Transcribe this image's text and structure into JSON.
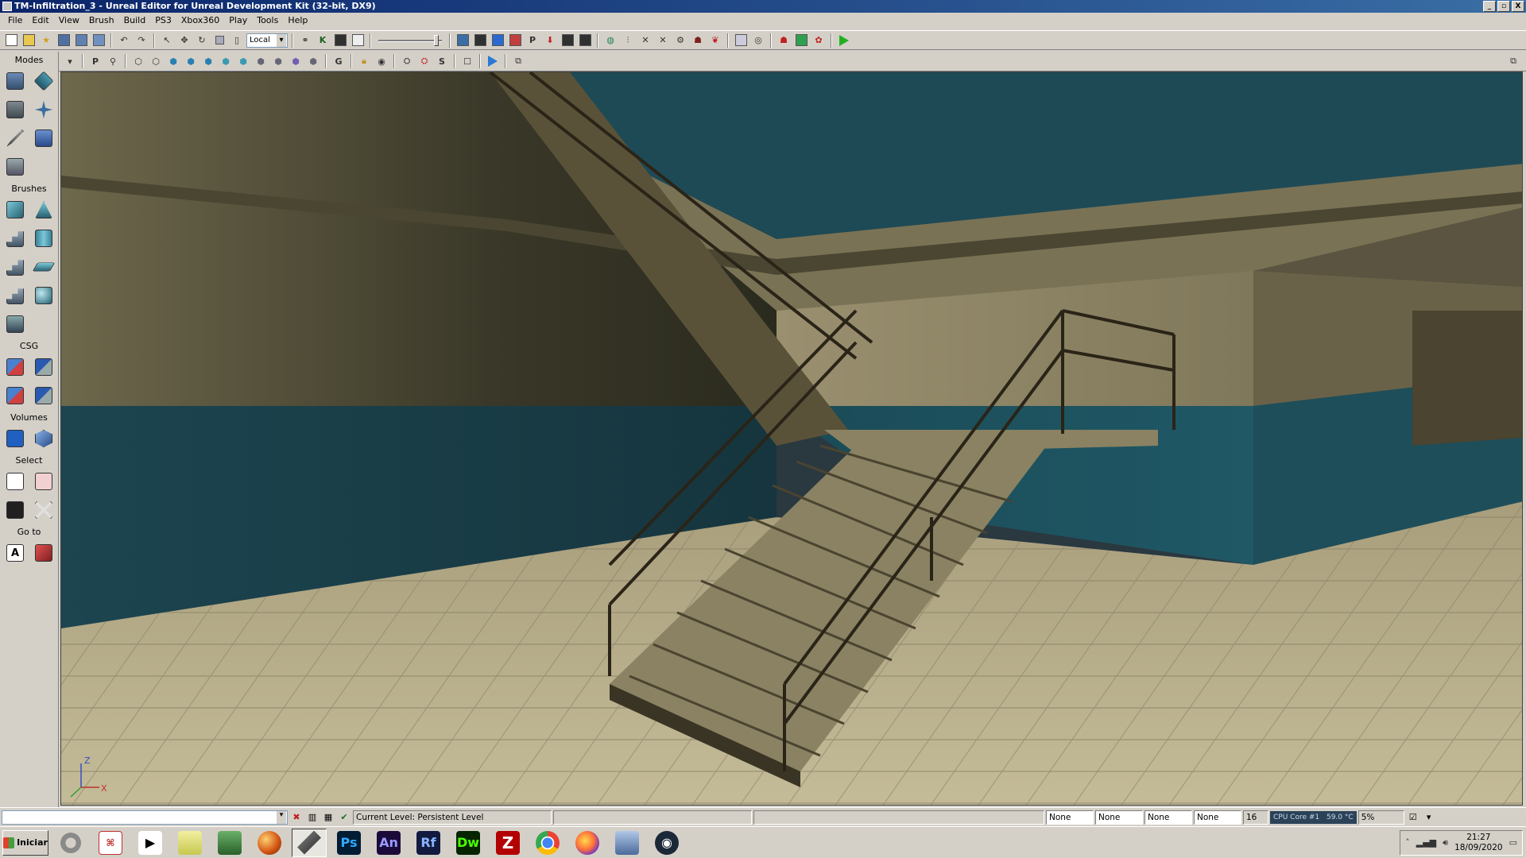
{
  "window": {
    "title": "TM-Infiltration_3 - Unreal Editor for Unreal Development Kit (32-bit, DX9)",
    "minimize": "_",
    "maximize": "▫",
    "close": "X"
  },
  "menu": [
    "File",
    "Edit",
    "View",
    "Brush",
    "Build",
    "PS3",
    "Xbox360",
    "Play",
    "Tools",
    "Help"
  ],
  "toolbar": {
    "coord_system": "Local",
    "viewport_bold_labels": {
      "p": "P",
      "g": "G",
      "s": "S",
      "k": "K"
    }
  },
  "modes_panel": {
    "modes_header": "Modes",
    "brushes_header": "Brushes",
    "csg_header": "CSG",
    "volumes_header": "Volumes",
    "select_header": "Select",
    "goto_header": "Go to",
    "goto_actor_label": "A"
  },
  "viewport": {
    "axis_z": "Z",
    "axis_x": "X",
    "colors": {
      "wall_upper": "#8c8460",
      "wall_lower": "#1e4a56",
      "floor": "#b8ae8a",
      "stair": "#9a9070",
      "rail": "#2a2418"
    }
  },
  "statusbar": {
    "current_level_label": "Current Level:",
    "current_level_value": "Persistent Level",
    "fields": [
      "None",
      "None",
      "None",
      "None"
    ],
    "grid_value": "16",
    "cpu_text": "CPU Core #1",
    "cpu_temp": "59.0 °C",
    "zoom": "5%"
  },
  "taskbar": {
    "start_label": "Iniciar",
    "ps_label": "Ps",
    "an_label": "An",
    "rf_label": "Rf",
    "dw_label": "Dw",
    "fz_label": "Z",
    "clock_time": "21:27",
    "clock_date": "18/09/2020"
  }
}
